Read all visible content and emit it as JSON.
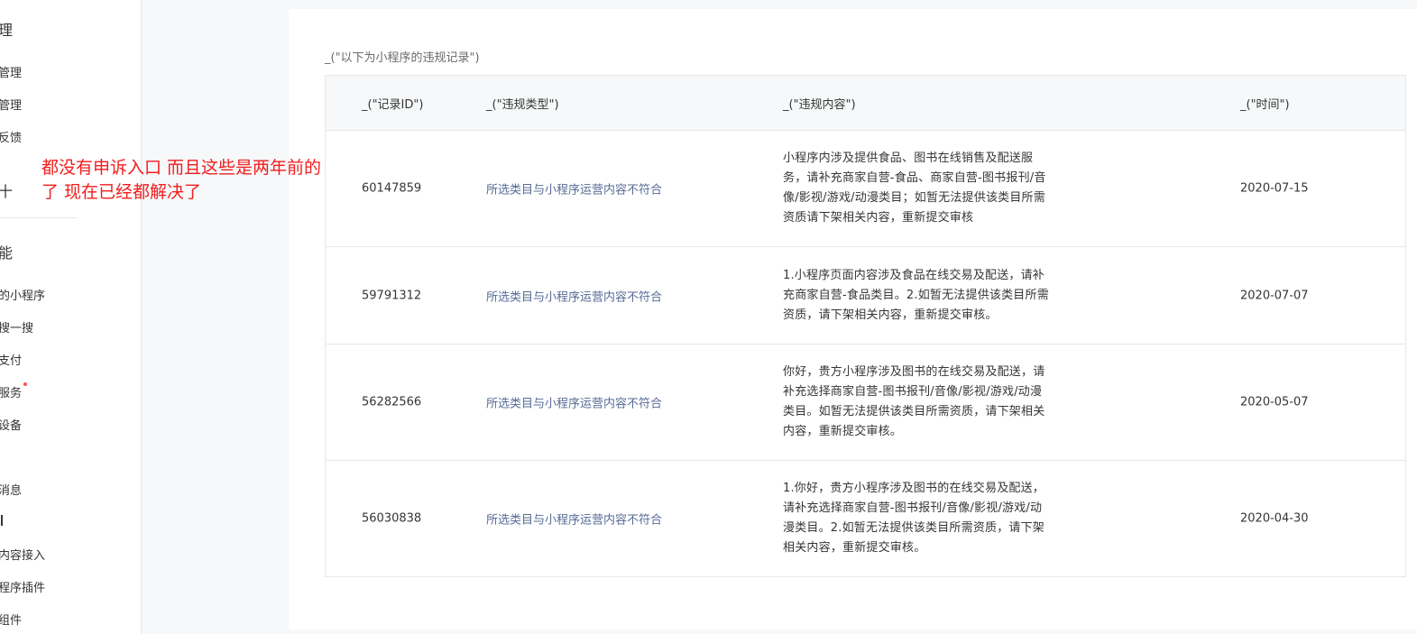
{
  "sidebar": {
    "section1_title": "理",
    "section1_items": [
      "管理",
      "管理",
      "反馈"
    ],
    "section2_title": "十",
    "section3_title": "能",
    "section3_items": [
      "的小程序",
      "搜一搜",
      "支付",
      "服务",
      "设备",
      "",
      "消息",
      "",
      "内容接入",
      "程序插件",
      "组件"
    ]
  },
  "annotation": {
    "text": "都没有申诉入口 而且这些是两年前的\n了 现在已经都解决了",
    "color": "#f21d1d"
  },
  "records": {
    "caption": "_(\"以下为小程序的违规记录\")",
    "headers": {
      "id": "_(\"记录ID\")",
      "type": "_(\"违规类型\")",
      "content": "_(\"违规内容\")",
      "time": "_(\"时间\")"
    },
    "rows": [
      {
        "id": "60147859",
        "type": "所选类目与小程序运营内容不符合",
        "content": "小程序内涉及提供食品、图书在线销售及配送服务，请补充商家自营-食品、商家自营-图书报刊/音像/影视/游戏/动漫类目；如暂无法提供该类目所需资质请下架相关内容，重新提交审核",
        "time": "2020-07-15"
      },
      {
        "id": "59791312",
        "type": "所选类目与小程序运营内容不符合",
        "content": "1.小程序页面内容涉及食品在线交易及配送，请补充商家自营-食品类目。2.如暂无法提供该类目所需资质，请下架相关内容，重新提交审核。",
        "time": "2020-07-07"
      },
      {
        "id": "56282566",
        "type": "所选类目与小程序运营内容不符合",
        "content": "你好，贵方小程序涉及图书的在线交易及配送，请补充选择商家自营-图书报刊/音像/影视/游戏/动漫类目。如暂无法提供该类目所需资质，请下架相关内容，重新提交审核。",
        "time": "2020-05-07"
      },
      {
        "id": "56030838",
        "type": "所选类目与小程序运营内容不符合",
        "content": "1.你好，贵方小程序涉及图书的在线交易及配送，请补充选择商家自营-图书报刊/音像/影视/游戏/动漫类目。2.如暂无法提供该类目所需资质，请下架相关内容，重新提交审核。",
        "time": "2020-04-30"
      }
    ]
  },
  "colors": {
    "link": "#576b95",
    "badge_dot": "#fa5151",
    "header_bg": "#f6f8f9"
  }
}
